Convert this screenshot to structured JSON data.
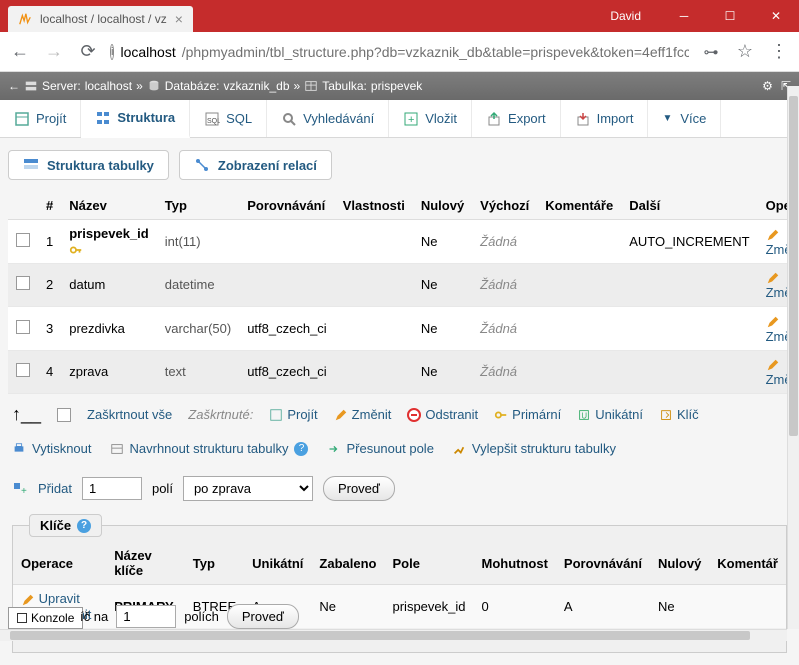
{
  "window": {
    "user": "David",
    "tab_title": "localhost / localhost / vz"
  },
  "url": {
    "host": "localhost",
    "path": "/phpmyadmin/tbl_structure.php?db=vzkaznik_db&table=prispevek&token=4eff1fcc..."
  },
  "breadcrumb": {
    "server_label": "Server:",
    "server": "localhost",
    "db_label": "Databáze:",
    "db": "vzkaznik_db",
    "table_label": "Tabulka:",
    "table": "prispevek"
  },
  "tabs": {
    "browse": "Projít",
    "structure": "Struktura",
    "sql": "SQL",
    "search": "Vyhledávání",
    "insert": "Vložit",
    "export": "Export",
    "import": "Import",
    "more": "Více"
  },
  "subtabs": {
    "table_structure": "Struktura tabulky",
    "relation_view": "Zobrazení relací"
  },
  "headers": {
    "num": "#",
    "name": "Název",
    "type": "Typ",
    "collation": "Porovnávání",
    "attributes": "Vlastnosti",
    "null": "Nulový",
    "default": "Výchozí",
    "comments": "Komentáře",
    "extra": "Další",
    "action": "Operace"
  },
  "cols": [
    {
      "i": "1",
      "name": "prispevek_id",
      "type": "int(11)",
      "coll": "",
      "null": "Ne",
      "def": "Žádná",
      "extra": "AUTO_INCREMENT",
      "key": true
    },
    {
      "i": "2",
      "name": "datum",
      "type": "datetime",
      "coll": "",
      "null": "Ne",
      "def": "Žádná",
      "extra": ""
    },
    {
      "i": "3",
      "name": "prezdivka",
      "type": "varchar(50)",
      "coll": "utf8_czech_ci",
      "null": "Ne",
      "def": "Žádná",
      "extra": ""
    },
    {
      "i": "4",
      "name": "zprava",
      "type": "text",
      "coll": "utf8_czech_ci",
      "null": "Ne",
      "def": "Žádná",
      "extra": ""
    }
  ],
  "ops": {
    "change": "Změnit"
  },
  "batch": {
    "check_all": "Zaškrtnout vše",
    "with_selected": "Zaškrtnuté:",
    "browse": "Projít",
    "change": "Změnit",
    "drop": "Odstranit",
    "primary": "Primární",
    "unique": "Unikátní",
    "index": "Klíč"
  },
  "links": {
    "print": "Vytisknout",
    "propose": "Navrhnout strukturu tabulky",
    "move": "Přesunout pole",
    "improve": "Vylepšit strukturu tabulky"
  },
  "addform": {
    "add": "Přidat",
    "count": "1",
    "fields": "polí",
    "after": "po zprava",
    "go": "Proveď"
  },
  "keys": {
    "legend": "Klíče",
    "h": {
      "action": "Operace",
      "keyname": "Název klíče",
      "type": "Typ",
      "unique": "Unikátní",
      "packed": "Zabaleno",
      "column": "Pole",
      "cardinality": "Mohutnost",
      "collation": "Porovnávání",
      "null": "Nulový",
      "comment": "Komentář"
    },
    "rows": [
      {
        "edit": "Upravit",
        "drop": "Odstranit",
        "keyname": "PRIMARY",
        "type": "BTREE",
        "unique": "Ano",
        "packed": "Ne",
        "column": "prispevek_id",
        "card": "0",
        "coll": "A",
        "null": "Ne"
      }
    ]
  },
  "bottom": {
    "on": "íč na",
    "count": "1",
    "fields": "polích",
    "go": "Proveď"
  },
  "console": "Konzole"
}
